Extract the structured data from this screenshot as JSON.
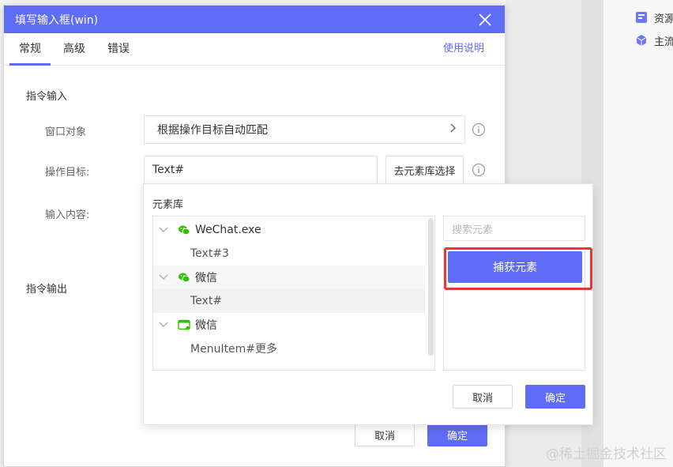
{
  "dialog": {
    "title": "填写输入框(win)",
    "tabs": [
      "常规",
      "高级",
      "错误"
    ],
    "active_tab": "常规",
    "help_link": "使用说明",
    "section_input": "指令输入",
    "section_output": "指令输出",
    "fields": {
      "window_label": "窗口对象",
      "window_value": "根据操作目标自动匹配",
      "target_label": "操作目标:",
      "target_value": "Text#",
      "target_picker": "去元素库选择",
      "content_label": "输入内容:"
    },
    "footer": {
      "cancel": "取消",
      "ok": "确定"
    }
  },
  "element_library": {
    "title": "元素库",
    "tree": [
      {
        "label": "WeChat.exe",
        "level": 0,
        "icon": "wechat-icon"
      },
      {
        "label": "Text#3",
        "level": 1
      },
      {
        "label": "微信",
        "level": 0,
        "icon": "wechat-icon"
      },
      {
        "label": "Text#",
        "level": 1,
        "selected": true
      },
      {
        "label": "微信",
        "level": 0,
        "icon": "window-icon"
      },
      {
        "label": "MenuItem#更多",
        "level": 1
      }
    ],
    "search_placeholder": "搜索元素",
    "capture_button": "捕获元素",
    "cancel": "取消",
    "ok": "确定"
  },
  "sidebar": {
    "items": [
      {
        "label": "资源",
        "icon": "resource-icon"
      },
      {
        "label": "主流",
        "icon": "cube-icon"
      }
    ]
  },
  "watermark": "@稀土掘金技术社区",
  "colors": {
    "accent": "#5f6cf5",
    "highlight": "#e53935",
    "wechat": "#2dc100"
  }
}
